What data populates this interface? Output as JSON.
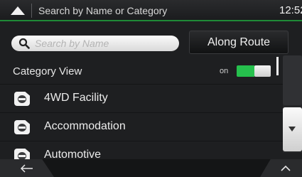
{
  "header": {
    "title": "Search by Name or Category",
    "clock": "12:52",
    "back_icon": "triangle-up-icon"
  },
  "search": {
    "placeholder": "Search by Name",
    "icon": "magnifier-icon"
  },
  "along_route_label": "Along Route",
  "category_view": {
    "label": "Category View",
    "toggle_state": "on",
    "accent_color": "#26c04d"
  },
  "categories": [
    {
      "label": "4WD Facility",
      "icon": "4wd-car-icon"
    },
    {
      "label": "Accommodation",
      "icon": "bed-icon"
    },
    {
      "label": "Automotive",
      "icon": "car-icon"
    }
  ],
  "footer": {
    "back_icon": "arrow-left-icon",
    "up_icon": "chevron-up-icon"
  },
  "colors": {
    "accent_line": "#1f8a37",
    "background": "#1e1f21"
  }
}
